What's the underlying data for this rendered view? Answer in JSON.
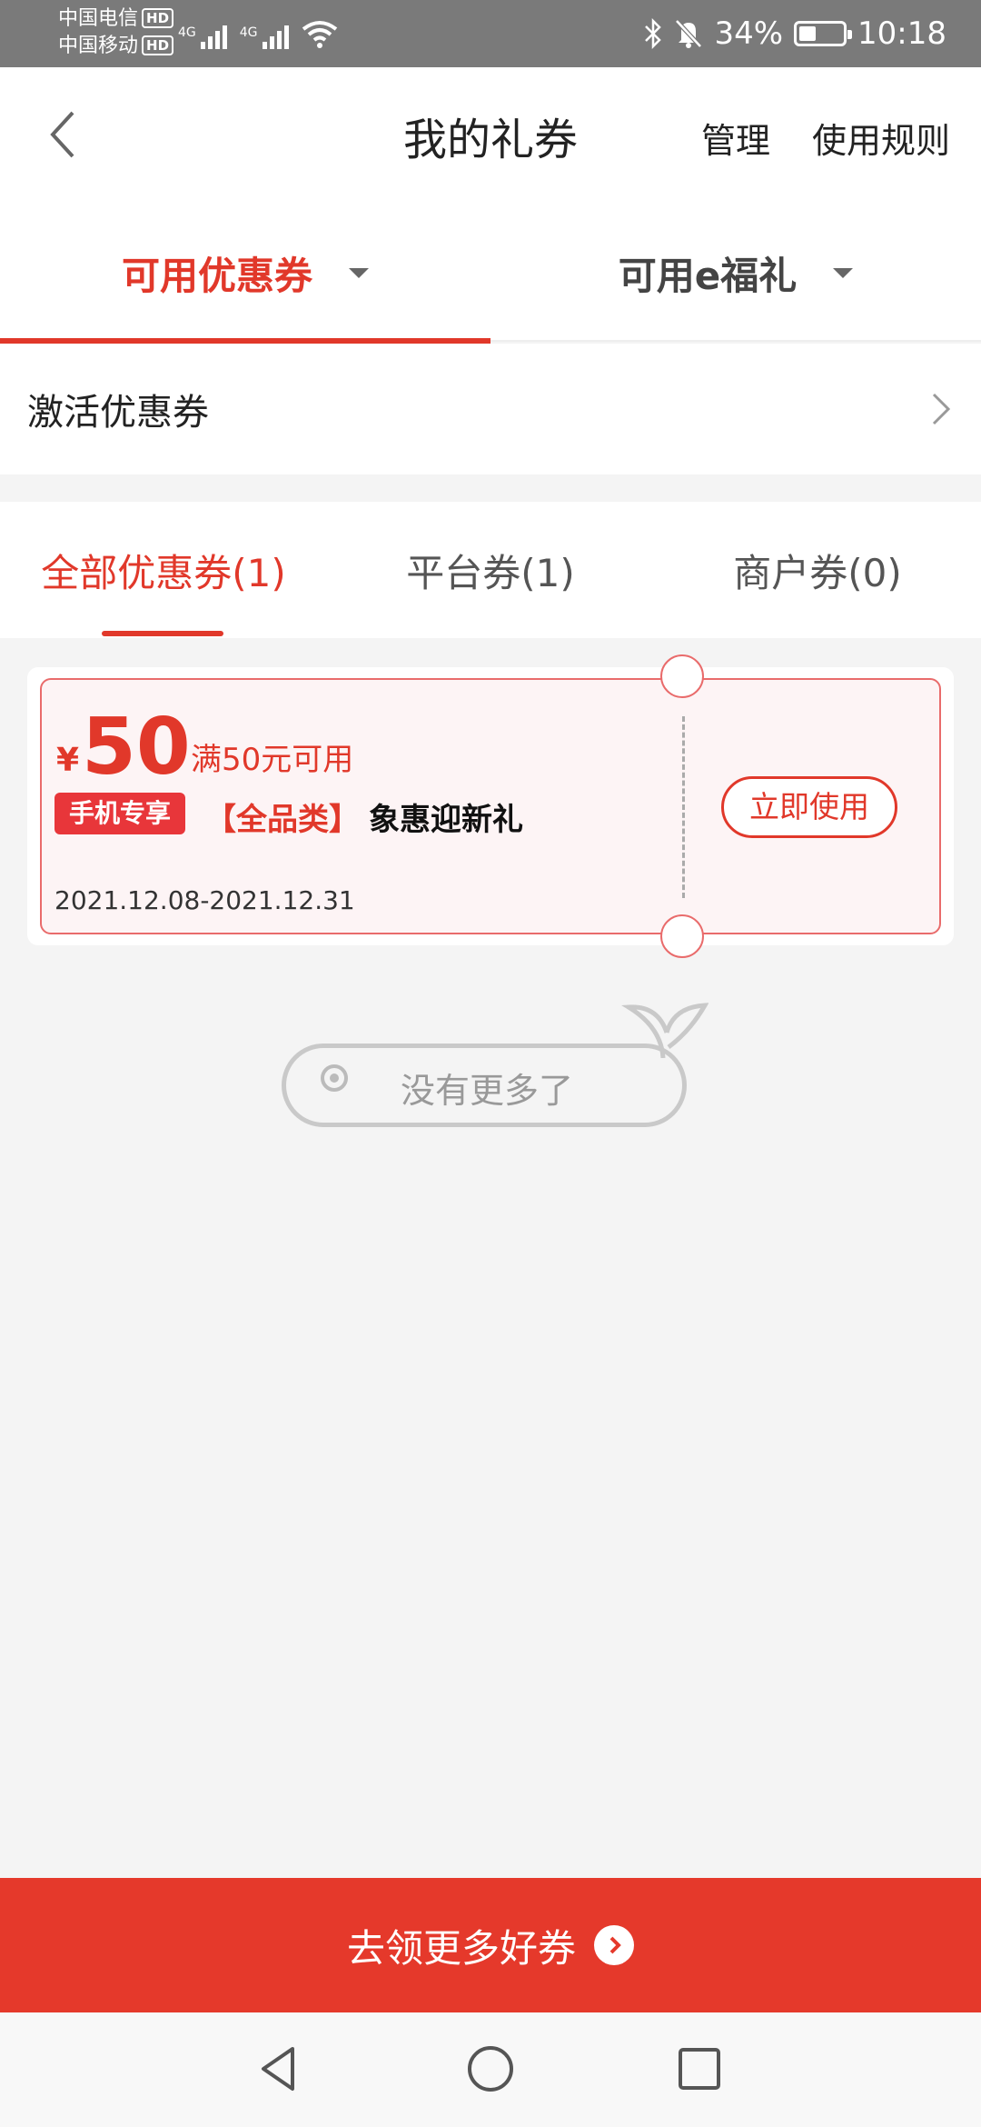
{
  "status_bar": {
    "carrier_1": "中国电信",
    "carrier_2": "中国移动",
    "hd_label": "HD",
    "network_1": "4G",
    "network_2": "4G",
    "battery": "34%",
    "battery_fraction": 0.34,
    "time": "10:18"
  },
  "header": {
    "title": "我的礼券",
    "manage_label": "管理",
    "rules_label": "使用规则"
  },
  "top_tabs": [
    {
      "label": "可用优惠券",
      "active": true
    },
    {
      "label": "可用e福礼",
      "active": false
    }
  ],
  "activate": {
    "label": "激活优惠券"
  },
  "sub_tabs": [
    {
      "label": "全部优惠券(1)",
      "active": true
    },
    {
      "label": "平台券(1)",
      "active": false
    },
    {
      "label": "商户券(0)",
      "active": false
    }
  ],
  "coupons": [
    {
      "currency": "¥",
      "amount": "50",
      "condition": "满50元可用",
      "badge": "手机专享",
      "category": "【全品类】",
      "name": "象惠迎新礼",
      "dates": "2021.12.08-2021.12.31",
      "action_label": "立即使用"
    }
  ],
  "empty_state": {
    "text": "没有更多了"
  },
  "bottom_button": {
    "label": "去领更多好券"
  },
  "colors": {
    "accent": "#e1382a",
    "status_bar": "#7a7a7a",
    "page_bg": "#f4f4f4",
    "coupon_bg": "#fdf4f5"
  },
  "icons": {
    "back": "chevron-left-icon",
    "activate_chevron": "chevron-right-icon",
    "tab_caret": "caret-down-icon",
    "bottom_arrow": "arrow-right-circle-icon",
    "nav_back": "triangle-back-icon",
    "nav_home": "circle-home-icon",
    "nav_recents": "square-recents-icon"
  }
}
